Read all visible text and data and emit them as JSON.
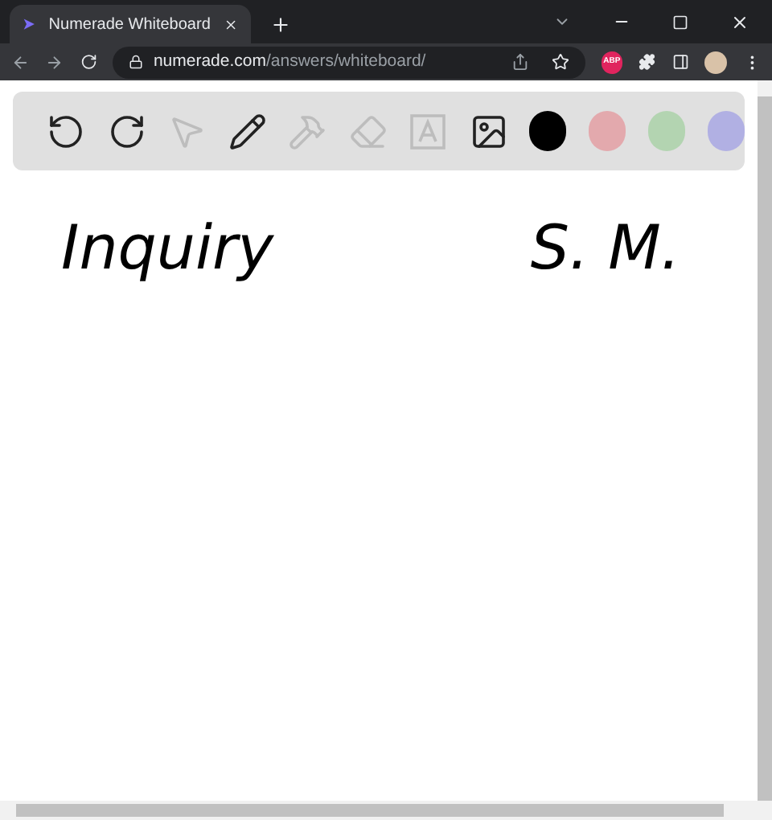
{
  "browser": {
    "tab": {
      "title": "Numerade Whiteboard"
    },
    "url": {
      "domain": "numerade.com",
      "path": "/answers/whiteboard/"
    },
    "extension_badge": "ABP"
  },
  "toolbar": {
    "tools": [
      {
        "kind": "undo",
        "disabled": false
      },
      {
        "kind": "redo",
        "disabled": false
      },
      {
        "kind": "select",
        "disabled": true
      },
      {
        "kind": "pen",
        "disabled": false
      },
      {
        "kind": "tools",
        "disabled": true
      },
      {
        "kind": "eraser",
        "disabled": true
      },
      {
        "kind": "text",
        "disabled": true
      },
      {
        "kind": "image",
        "disabled": false
      }
    ],
    "colors": [
      {
        "color": "#000000"
      },
      {
        "color": "#e3a9ad"
      },
      {
        "color": "#b3d4b1"
      },
      {
        "color": "#b1b0e3"
      }
    ]
  },
  "board": {
    "notes": [
      "Inquiry",
      "S. M."
    ]
  }
}
